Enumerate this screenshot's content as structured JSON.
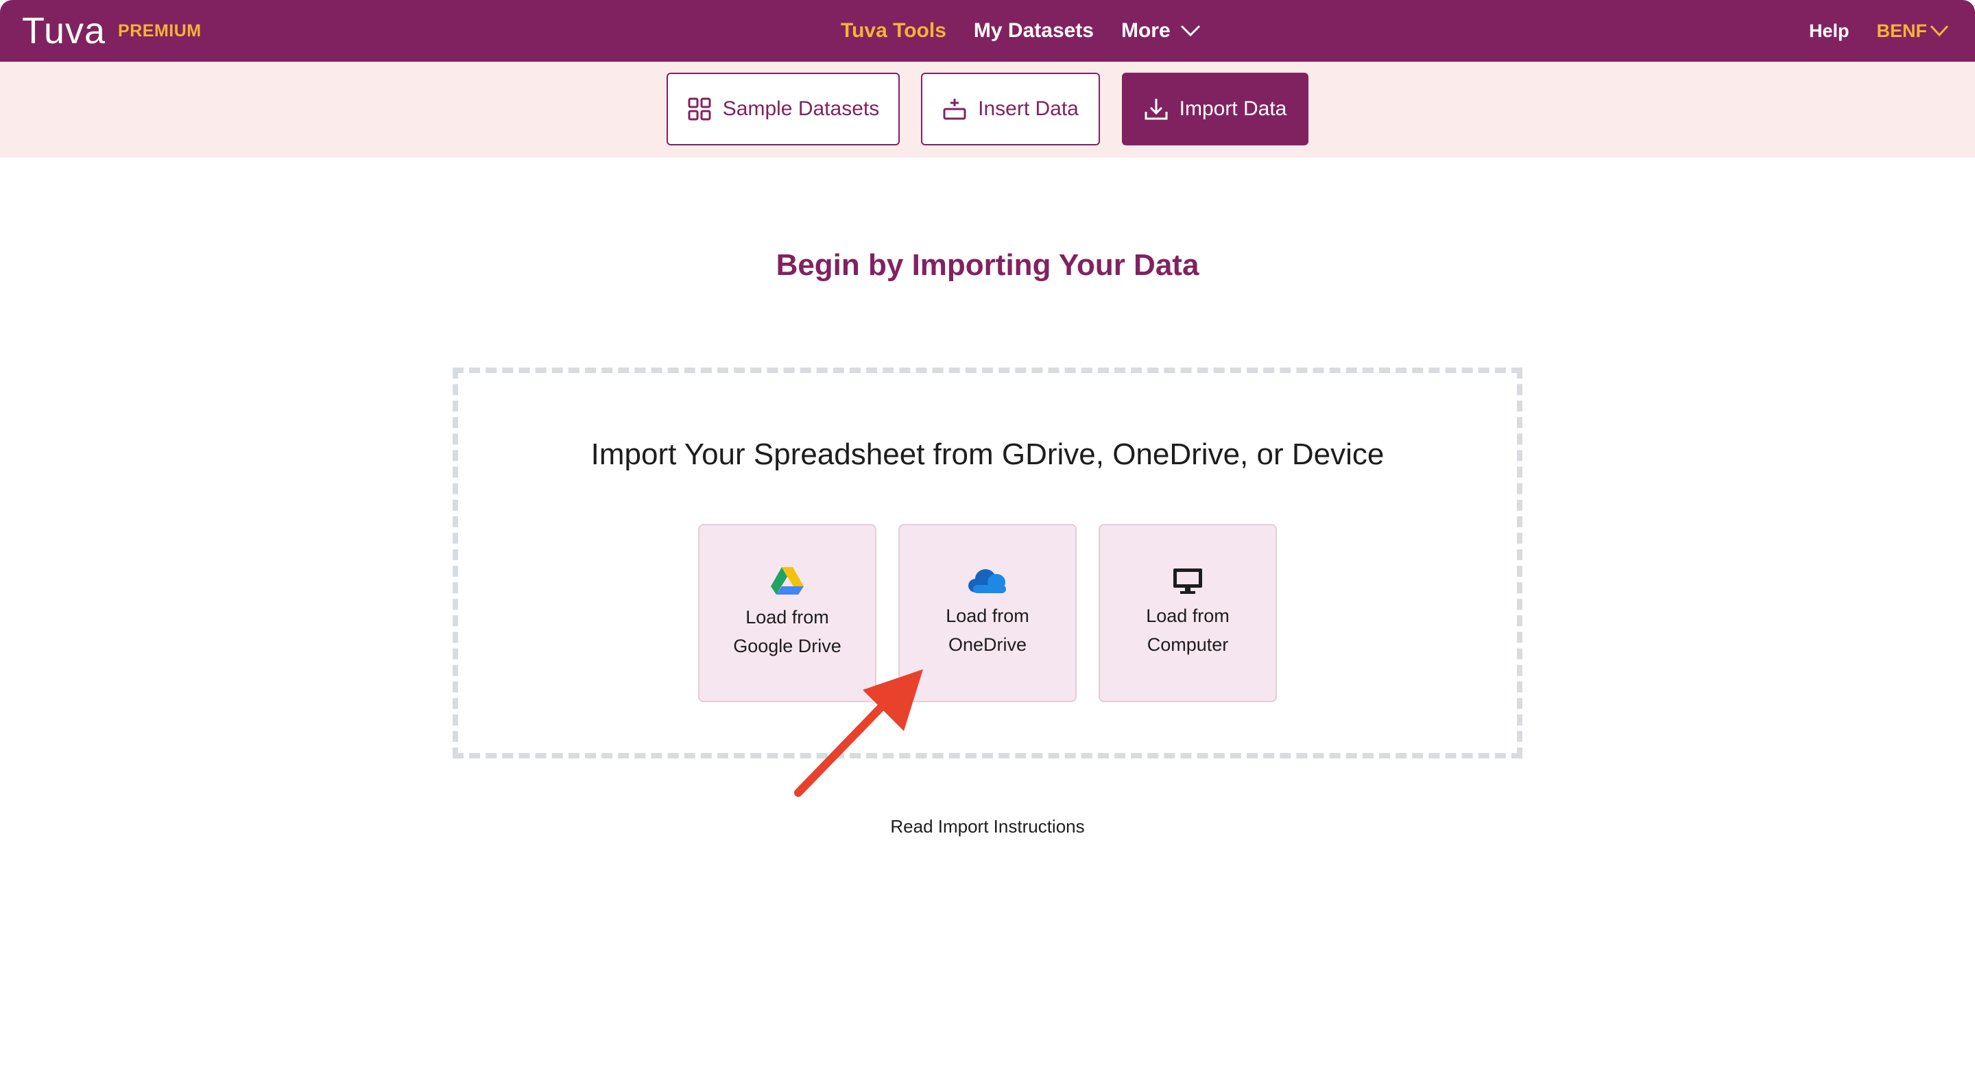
{
  "nav": {
    "logo": "Tuva",
    "premium": "PREMIUM",
    "items": [
      {
        "label": "Tuva Tools",
        "active": true
      },
      {
        "label": "My Datasets",
        "active": false
      },
      {
        "label": "More",
        "active": false
      }
    ],
    "help": "Help",
    "user": "BENF"
  },
  "toolbar": {
    "sample": "Sample Datasets",
    "insert": "Insert Data",
    "import": "Import Data"
  },
  "main": {
    "headline": "Begin by Importing Your Data",
    "dropzone_title": "Import Your Spreadsheet from GDrive, OneDrive, or Device",
    "cards": [
      {
        "line1": "Load from",
        "line2": "Google Drive",
        "icon": "google-drive-icon"
      },
      {
        "line1": "Load from",
        "line2": "OneDrive",
        "icon": "onedrive-icon"
      },
      {
        "line1": "Load from",
        "line2": "Computer",
        "icon": "monitor-icon"
      }
    ],
    "instructions": "Read Import Instructions"
  },
  "colors": {
    "brand": "#812260",
    "accent": "#f5b335",
    "subbar": "#fbeceb",
    "card": "#f6e6ef",
    "annotation_arrow": "#e8412c"
  }
}
